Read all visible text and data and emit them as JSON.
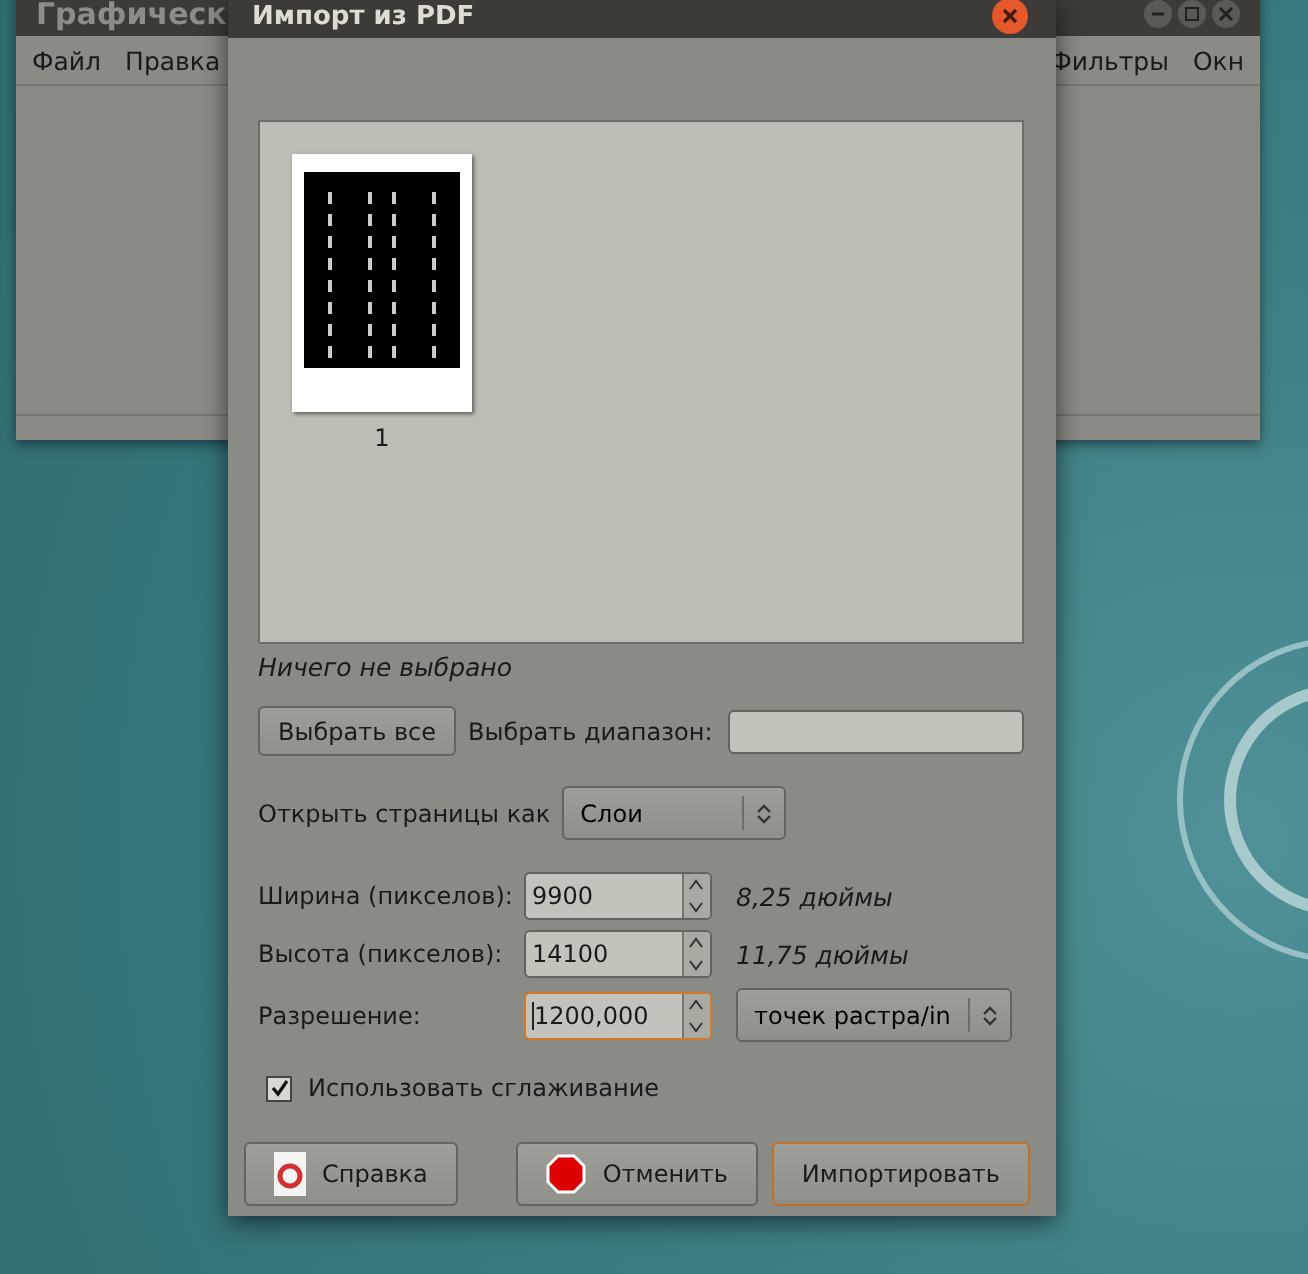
{
  "background_window": {
    "title": "Графическ",
    "menu": [
      "Файл",
      "Правка",
      "Фильтры",
      "Окн"
    ]
  },
  "dialog": {
    "title": "Импорт из PDF",
    "pages": [
      {
        "number": "1",
        "selected": false
      }
    ],
    "status": "Ничего не выбрано",
    "select_all_button": "Выбрать все",
    "range": {
      "label": "Выбрать диапазон:"
    },
    "open_as": {
      "label": "Открыть страницы как",
      "value": "Слои"
    },
    "size_fields": [
      {
        "label": "Ширина (пикселов):",
        "value": "9900",
        "focused": false,
        "unit": "8,25 дюймы",
        "kind": "text"
      },
      {
        "label": "Высота (пикселов):",
        "value": "14100",
        "focused": false,
        "unit": "11,75 дюймы",
        "kind": "text"
      },
      {
        "label": "Разрешение:",
        "value": "1200,000",
        "focused": true,
        "unit": "точек растра/in",
        "kind": "combo"
      }
    ],
    "antialias": {
      "label": "Использовать сглаживание",
      "checked": true
    },
    "buttons": [
      {
        "label": "Справка",
        "kind": "help",
        "default": false
      },
      {
        "label": "Отменить",
        "kind": "cancel",
        "default": false
      },
      {
        "label": "Импортировать",
        "kind": "plain",
        "default": true
      }
    ]
  }
}
